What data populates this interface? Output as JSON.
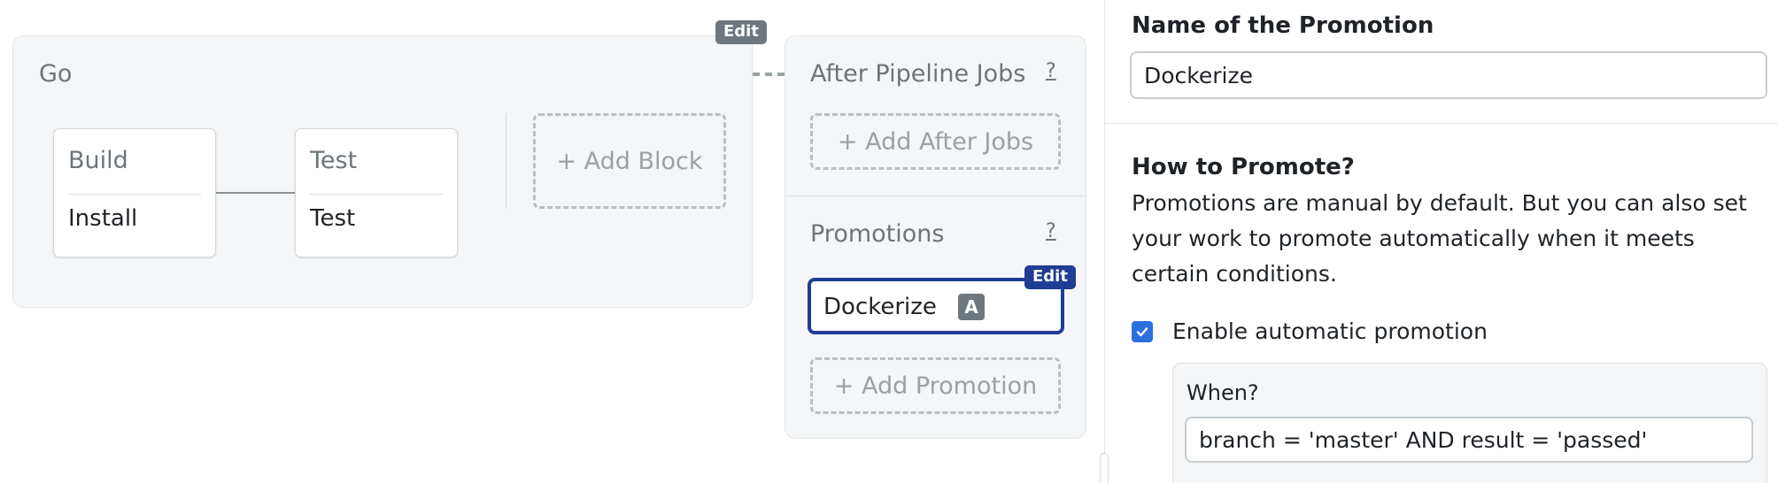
{
  "pipeline": {
    "edit_label": "Edit",
    "block_name": "Go",
    "jobs": [
      {
        "block": "Build",
        "job": "Install"
      },
      {
        "block": "Test",
        "job": "Test"
      }
    ],
    "add_block_label": "+ Add Block"
  },
  "after_pipeline": {
    "heading": "After Pipeline Jobs",
    "help": "?",
    "add_label": "+ Add After Jobs"
  },
  "promotions": {
    "heading": "Promotions",
    "help": "?",
    "edit_label": "Edit",
    "items": [
      {
        "name": "Dockerize",
        "tag": "A"
      }
    ],
    "add_label": "+ Add Promotion"
  },
  "form": {
    "name_label": "Name of the Promotion",
    "name_value": "Dockerize",
    "how_heading": "How to Promote?",
    "how_description": "Promotions are manual by default. But you can also set your work to promote automatically when it meets certain conditions.",
    "auto_label": "Enable automatic promotion",
    "auto_checked": true,
    "when_label": "When?",
    "when_value": "branch = 'master' AND result = 'passed'"
  },
  "colors": {
    "accent": "#1f3d94",
    "checkbox": "#2e6fe0",
    "badge_gray": "#6d777d"
  }
}
